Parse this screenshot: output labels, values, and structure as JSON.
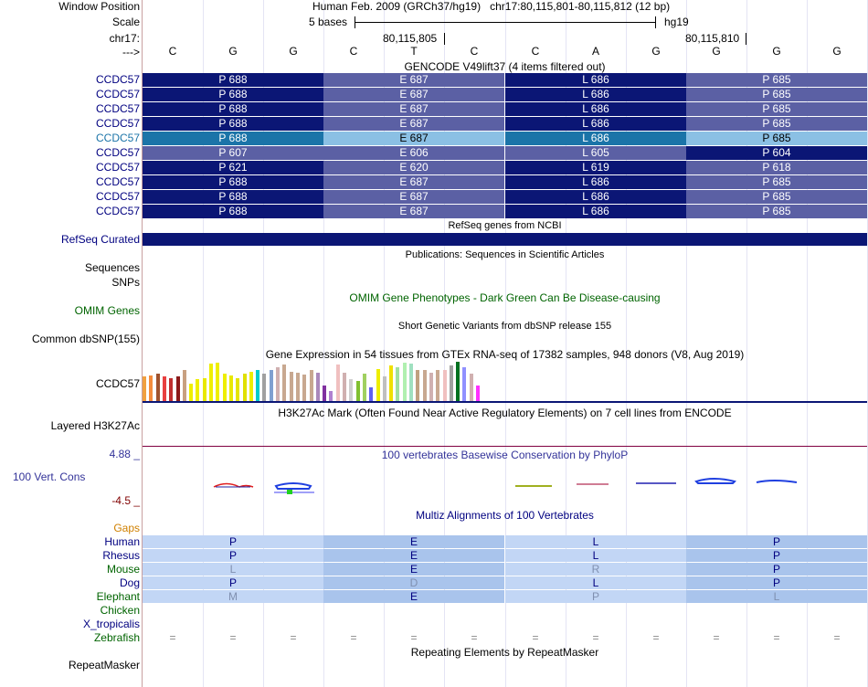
{
  "header": {
    "window_position_label": "Window Position",
    "window_position_value": "Human Feb. 2009 (GRCh37/hg19)   chr17:80,115,801-80,115,812 (12 bp)",
    "scale_label": "Scale",
    "scale_text": "5 bases",
    "scale_assembly": "hg19",
    "chrom_label": "chr17:",
    "coord1": "80,115,805",
    "coord2": "80,115,810",
    "strand_label": "--->",
    "bases": [
      "C",
      "G",
      "G",
      "C",
      "T",
      "C",
      "C",
      "A",
      "G",
      "G",
      "G",
      "G"
    ]
  },
  "gencode": {
    "title": "GENCODE V49lift37 (4 items filtered out)",
    "rows": [
      {
        "label": "CCDC57",
        "aa": [
          "P 688",
          "E 687",
          "L 686",
          "P 685"
        ]
      },
      {
        "label": "CCDC57",
        "aa": [
          "P 688",
          "E 687",
          "L 686",
          "P 685"
        ]
      },
      {
        "label": "CCDC57",
        "aa": [
          "P 688",
          "E 687",
          "L 686",
          "P 685"
        ]
      },
      {
        "label": "CCDC57",
        "aa": [
          "P 688",
          "E 687",
          "L 686",
          "P 685"
        ]
      },
      {
        "label": "CCDC57",
        "aa": [
          "P 688",
          "E 687",
          "L 686",
          "P 685"
        ]
      },
      {
        "label": "CCDC57",
        "aa": [
          "P 607",
          "E 606",
          "L 605",
          "P 604"
        ]
      },
      {
        "label": "CCDC57",
        "aa": [
          "P 621",
          "E 620",
          "L 619",
          "P 618"
        ]
      },
      {
        "label": "CCDC57",
        "aa": [
          "P 688",
          "E 687",
          "L 686",
          "P 685"
        ]
      },
      {
        "label": "CCDC57",
        "aa": [
          "P 688",
          "E 687",
          "L 686",
          "P 685"
        ]
      },
      {
        "label": "CCDC57",
        "aa": [
          "P 688",
          "E 687",
          "L 686",
          "P 685"
        ]
      }
    ]
  },
  "refseq": {
    "title": "RefSeq genes from NCBI",
    "label": "RefSeq Curated"
  },
  "publications": {
    "title": "Publications: Sequences in Scientific Articles",
    "label1": "Sequences",
    "label2": "SNPs"
  },
  "omim": {
    "title": "OMIM Gene Phenotypes - Dark Green Can Be Disease-causing",
    "label": "OMIM Genes"
  },
  "dbsnp": {
    "title": "Short Genetic Variants from dbSNP release 155",
    "label": "Common dbSNP(155)"
  },
  "gtex": {
    "title": "Gene Expression in 54 tissues from GTEx RNA-seq of 17382 samples, 948 donors (V8, Aug 2019)",
    "label": "CCDC57",
    "bars": [
      {
        "h": 0.62,
        "c": "#f0a040"
      },
      {
        "h": 0.65,
        "c": "#f58c3c"
      },
      {
        "h": 0.7,
        "c": "#a0522d"
      },
      {
        "h": 0.62,
        "c": "#e84040"
      },
      {
        "h": 0.58,
        "c": "#c03030"
      },
      {
        "h": 0.62,
        "c": "#8b1a1a"
      },
      {
        "h": 0.78,
        "c": "#c8a080"
      },
      {
        "h": 0.45,
        "c": "#eeee00"
      },
      {
        "h": 0.55,
        "c": "#eeee00"
      },
      {
        "h": 0.58,
        "c": "#e8e800"
      },
      {
        "h": 0.95,
        "c": "#eeee00"
      },
      {
        "h": 0.98,
        "c": "#eeee00"
      },
      {
        "h": 0.7,
        "c": "#eeee00"
      },
      {
        "h": 0.65,
        "c": "#e8e800"
      },
      {
        "h": 0.58,
        "c": "#e4e400"
      },
      {
        "h": 0.7,
        "c": "#e0e000"
      },
      {
        "h": 0.75,
        "c": "#eeee00"
      },
      {
        "h": 0.78,
        "c": "#00cccc"
      },
      {
        "h": 0.7,
        "c": "#a0a0a0"
      },
      {
        "h": 0.8,
        "c": "#7fa0d0"
      },
      {
        "h": 0.85,
        "c": "#d0b0b0"
      },
      {
        "h": 0.92,
        "c": "#c8a890"
      },
      {
        "h": 0.75,
        "c": "#c8a890"
      },
      {
        "h": 0.72,
        "c": "#c8a890"
      },
      {
        "h": 0.68,
        "c": "#c8a890"
      },
      {
        "h": 0.8,
        "c": "#c8a890"
      },
      {
        "h": 0.72,
        "c": "#aa88bb"
      },
      {
        "h": 0.4,
        "c": "#8030a0"
      },
      {
        "h": 0.25,
        "c": "#b080d0"
      },
      {
        "h": 0.92,
        "c": "#f0c0c0"
      },
      {
        "h": 0.72,
        "c": "#d0b0b0"
      },
      {
        "h": 0.55,
        "c": "#d0d0d0"
      },
      {
        "h": 0.5,
        "c": "#80c030"
      },
      {
        "h": 0.7,
        "c": "#a0d060"
      },
      {
        "h": 0.35,
        "c": "#6060f0"
      },
      {
        "h": 0.82,
        "c": "#eeee00"
      },
      {
        "h": 0.62,
        "c": "#c0c0c0"
      },
      {
        "h": 0.9,
        "c": "#f0e000"
      },
      {
        "h": 0.85,
        "c": "#a0e0a0"
      },
      {
        "h": 0.98,
        "c": "#b0f0b0"
      },
      {
        "h": 0.95,
        "c": "#a0e0c0"
      },
      {
        "h": 0.78,
        "c": "#c0a080"
      },
      {
        "h": 0.8,
        "c": "#c8a890"
      },
      {
        "h": 0.72,
        "c": "#d0b0b0"
      },
      {
        "h": 0.78,
        "c": "#c8a890"
      },
      {
        "h": 0.8,
        "c": "#f0c0c0"
      },
      {
        "h": 0.9,
        "c": "#a0a0a0"
      },
      {
        "h": 1.0,
        "c": "#007020"
      },
      {
        "h": 0.85,
        "c": "#9090ff"
      },
      {
        "h": 0.7,
        "c": "#d0b0b0"
      },
      {
        "h": 0.4,
        "c": "#ff30ff"
      }
    ]
  },
  "h3k27ac": {
    "title": "H3K27Ac Mark (Often Found Near Active Regulatory Elements) on 7 cell lines from ENCODE",
    "label": "Layered H3K27Ac"
  },
  "phylop": {
    "title": "100 vertebrates Basewise Conservation by PhyloP",
    "label": "100 Vert. Cons",
    "max": "4.88 _",
    "min": "-4.5 _"
  },
  "multiz": {
    "title": "Multiz Alignments of 100 Vertebrates",
    "gaps_label": "Gaps",
    "rows": [
      {
        "label": "Human",
        "color": "#000080",
        "aa": [
          "P",
          "E",
          "L",
          "P"
        ],
        "faint": [
          false,
          false,
          false,
          false
        ]
      },
      {
        "label": "Rhesus",
        "color": "#000080",
        "aa": [
          "P",
          "E",
          "L",
          "P"
        ],
        "faint": [
          false,
          false,
          false,
          false
        ]
      },
      {
        "label": "Mouse",
        "color": "#006400",
        "aa": [
          "L",
          "E",
          "R",
          "P"
        ],
        "faint": [
          true,
          false,
          true,
          false
        ]
      },
      {
        "label": "Dog",
        "color": "#000080",
        "aa": [
          "P",
          "D",
          "L",
          "P"
        ],
        "faint": [
          false,
          true,
          false,
          false
        ]
      },
      {
        "label": "Elephant",
        "color": "#006400",
        "aa": [
          "M",
          "E",
          "P",
          "L"
        ],
        "faint": [
          true,
          false,
          true,
          true
        ]
      },
      {
        "label": "Chicken",
        "color": "#006400",
        "aa": [
          "",
          "",
          "",
          ""
        ],
        "faint": [
          false,
          false,
          false,
          false
        ]
      },
      {
        "label": "X_tropicalis",
        "color": "#000080",
        "aa": [
          "",
          "",
          "",
          ""
        ],
        "faint": [
          false,
          false,
          false,
          false
        ]
      },
      {
        "label": "Zebrafish",
        "color": "#006400",
        "aa": [
          "=",
          "=",
          "=",
          "=",
          "=",
          "=",
          "=",
          "=",
          "=",
          "=",
          "=",
          "="
        ],
        "faint": []
      }
    ]
  },
  "repeatmasker": {
    "title": "Repeating Elements by RepeatMasker",
    "label": "RepeatMasker"
  },
  "colors": {
    "gencode_dark": "#0b1675",
    "gencode_mid": "#5b60a4",
    "track_label": "#000080",
    "omim": "#006400",
    "gaps": "#d08000"
  }
}
